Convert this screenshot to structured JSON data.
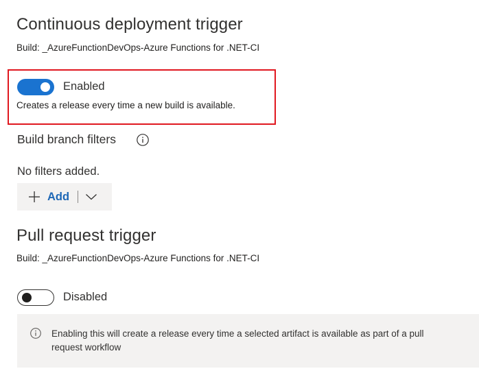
{
  "cd": {
    "title": "Continuous deployment trigger",
    "build": "Build: _AzureFunctionDevOps-Azure Functions for .NET-CI",
    "toggle_label": "Enabled",
    "toggle_on": true,
    "description": "Creates a release every time a new build is available."
  },
  "filters": {
    "title": "Build branch filters",
    "info_icon": "info-icon",
    "empty_text": "No filters added.",
    "add_label": "Add",
    "add_icon": "plus-icon",
    "dropdown_icon": "chevron-down-icon"
  },
  "pr": {
    "title": "Pull request trigger",
    "build": "Build: _AzureFunctionDevOps-Azure Functions for .NET-CI",
    "toggle_label": "Disabled",
    "toggle_on": false,
    "info_line1": "Enabling this will create a release every time a selected artifact is available as part of a pull",
    "info_line2": "request workflow"
  },
  "colors": {
    "accent": "#1a73d0",
    "highlight_border": "#e0161e",
    "link": "#1e68b6",
    "panel_bg": "#f3f2f1"
  }
}
